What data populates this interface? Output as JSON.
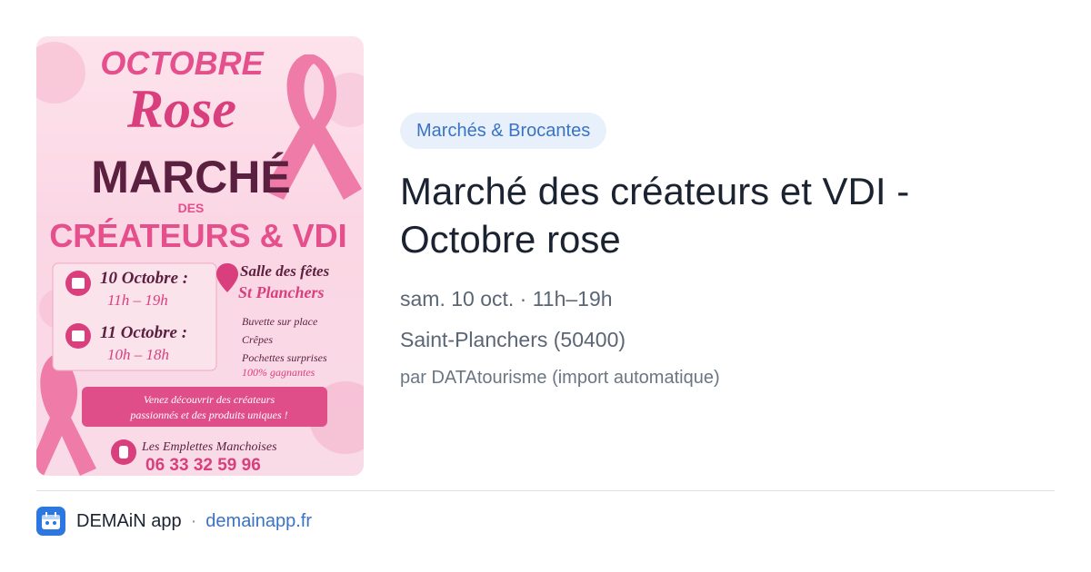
{
  "poster": {
    "header_line1": "OCTOBRE",
    "header_line2": "Rose",
    "marche": "MARCHÉ",
    "des": "DES",
    "createurs": "CRÉATEURS & VDI",
    "date1": "10 Octobre :",
    "hours1": "11h – 19h",
    "date2": "11 Octobre :",
    "hours2": "10h – 18h",
    "venue1": "Salle des fêtes",
    "venue2": "St Planchers",
    "feature1": "Buvette sur place",
    "feature2": "Crêpes",
    "feature3a": "Pochettes surprises",
    "feature3b": "100% gagnantes",
    "banner1": "Venez découvrir des créateurs",
    "banner2": "passionnés et des produits uniques !",
    "contact_name": "Les Emplettes Manchoises",
    "contact_phone": "06 33 32 59 96",
    "colors": {
      "pink": "#e44f8c",
      "plum": "#5b1f3f",
      "ribbon": "#ee7ba8"
    }
  },
  "event": {
    "category": "Marchés & Brocantes",
    "title_line1": "Marché des créateurs et VDI -",
    "title_line2": "Octobre rose",
    "datetime": "sam. 10 oct. · 11h–19h",
    "location": "Saint-Planchers (50400)",
    "source": "par DATAtourisme (import automatique)"
  },
  "footer": {
    "app_name": "DEMAiN app",
    "separator": "·",
    "app_url": "demainapp.fr",
    "icon": "demain-app-logo-icon"
  }
}
